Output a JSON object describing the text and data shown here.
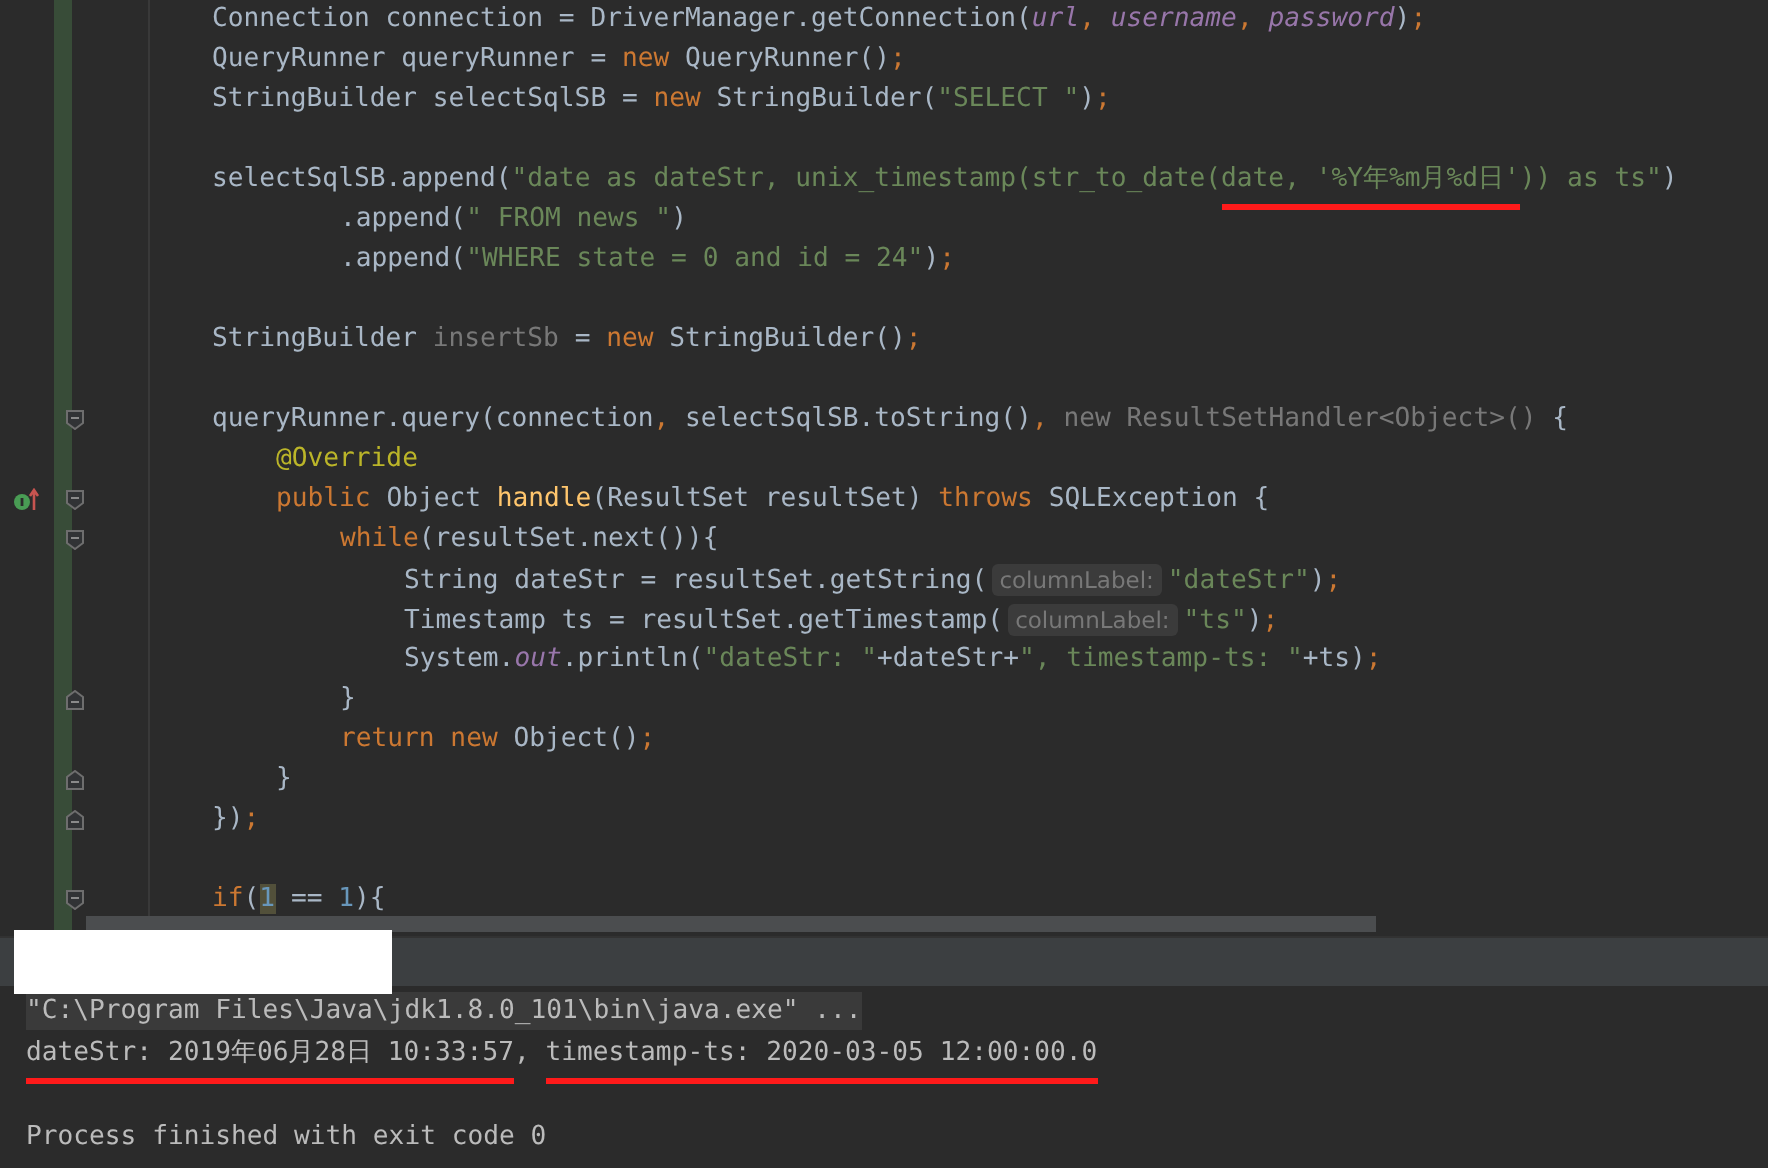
{
  "editor": {
    "lines": [
      {
        "kind": "statement",
        "tokens": [
          {
            "kind": "p",
            "text": "Connection connection = DriverManager.getConnection("
          },
          {
            "kind": "v",
            "text": "url"
          },
          {
            "kind": "c",
            "text": ", "
          },
          {
            "kind": "v",
            "text": "username"
          },
          {
            "kind": "c",
            "text": ", "
          },
          {
            "kind": "v",
            "text": "password"
          },
          {
            "kind": "p",
            "text": ")"
          },
          {
            "kind": "c",
            "text": ";"
          }
        ]
      },
      {
        "kind": "statement",
        "tokens": [
          {
            "kind": "p",
            "text": "QueryRunner queryRunner = "
          },
          {
            "kind": "k",
            "text": "new"
          },
          {
            "kind": "p",
            "text": " QueryRunner()"
          },
          {
            "kind": "c",
            "text": ";"
          }
        ]
      },
      {
        "kind": "statement",
        "tokens": [
          {
            "kind": "p",
            "text": "StringBuilder selectSqlSB = "
          },
          {
            "kind": "k",
            "text": "new"
          },
          {
            "kind": "p",
            "text": " StringBuilder("
          },
          {
            "kind": "s",
            "text": "\"SELECT \""
          },
          {
            "kind": "p",
            "text": ")"
          },
          {
            "kind": "c",
            "text": ";"
          }
        ]
      },
      {
        "kind": "blank"
      },
      {
        "kind": "statement",
        "tokens": [
          {
            "kind": "p",
            "text": "selectSqlSB.append("
          },
          {
            "kind": "s",
            "text": "\"date as dateStr, unix_timestamp(str_to_date("
          },
          {
            "kind": "s",
            "text": "date, '%Y年%m月%d日'",
            "underlined": true
          },
          {
            "kind": "s",
            "text": ")) as ts\""
          },
          {
            "kind": "p",
            "text": ")"
          }
        ]
      },
      {
        "kind": "continuation",
        "tokens": [
          {
            "kind": "p",
            "text": ".append("
          },
          {
            "kind": "s",
            "text": "\" FROM news \""
          },
          {
            "kind": "p",
            "text": ")"
          }
        ]
      },
      {
        "kind": "continuation",
        "tokens": [
          {
            "kind": "p",
            "text": ".append("
          },
          {
            "kind": "s",
            "text": "\"WHERE state = 0 and id = 24\""
          },
          {
            "kind": "p",
            "text": ")"
          },
          {
            "kind": "c",
            "text": ";"
          }
        ]
      },
      {
        "kind": "blank"
      },
      {
        "kind": "statement",
        "tokens": [
          {
            "kind": "p",
            "text": "StringBuilder "
          },
          {
            "kind": "g",
            "text": "insertSb"
          },
          {
            "kind": "p",
            "text": " = "
          },
          {
            "kind": "k",
            "text": "new"
          },
          {
            "kind": "p",
            "text": " StringBuilder()"
          },
          {
            "kind": "c",
            "text": ";"
          }
        ]
      },
      {
        "kind": "blank"
      },
      {
        "kind": "statement",
        "gutter": [
          {
            "kind": "fold-start"
          }
        ],
        "tokens": [
          {
            "kind": "p",
            "text": "queryRunner.query(connection"
          },
          {
            "kind": "c",
            "text": ", "
          },
          {
            "kind": "p",
            "text": "selectSqlSB.toString()"
          },
          {
            "kind": "c",
            "text": ", "
          },
          {
            "kind": "g",
            "text": "new ResultSetHandler<Object>()"
          },
          {
            "kind": "p",
            "text": " {"
          }
        ],
        "children": [
          {
            "kind": "statement",
            "tokens": [
              {
                "kind": "a",
                "text": "@Override"
              }
            ]
          },
          {
            "kind": "statement",
            "gutter": [
              {
                "kind": "override"
              },
              {
                "kind": "fold-start"
              }
            ],
            "tokens": [
              {
                "kind": "k",
                "text": "public "
              },
              {
                "kind": "p",
                "text": "Object "
              },
              {
                "kind": "m",
                "text": "handle"
              },
              {
                "kind": "p",
                "text": "(ResultSet resultSet) "
              },
              {
                "kind": "k",
                "text": "throws "
              },
              {
                "kind": "p",
                "text": "SQLException {"
              }
            ],
            "children": [
              {
                "kind": "statement",
                "gutter": [
                  {
                    "kind": "fold-start"
                  }
                ],
                "tokens": [
                  {
                    "kind": "k",
                    "text": "while"
                  },
                  {
                    "kind": "p",
                    "text": "(resultSet.next()){"
                  }
                ],
                "children": [
                  {
                    "kind": "statement",
                    "tokens": [
                      {
                        "kind": "p",
                        "text": "String dateStr = resultSet.getString("
                      },
                      {
                        "kind": "h",
                        "text": "columnLabel:"
                      },
                      {
                        "kind": "s",
                        "text": "\"dateStr\""
                      },
                      {
                        "kind": "p",
                        "text": ")"
                      },
                      {
                        "kind": "c",
                        "text": ";"
                      }
                    ]
                  },
                  {
                    "kind": "statement",
                    "tokens": [
                      {
                        "kind": "p",
                        "text": "Timestamp ts = resultSet.getTimestamp("
                      },
                      {
                        "kind": "h",
                        "text": "columnLabel:"
                      },
                      {
                        "kind": "s",
                        "text": "\"ts\""
                      },
                      {
                        "kind": "p",
                        "text": ")"
                      },
                      {
                        "kind": "c",
                        "text": ";"
                      }
                    ]
                  },
                  {
                    "kind": "statement",
                    "tokens": [
                      {
                        "kind": "p",
                        "text": "System."
                      },
                      {
                        "kind": "v",
                        "text": "out"
                      },
                      {
                        "kind": "p",
                        "text": ".println("
                      },
                      {
                        "kind": "s",
                        "text": "\"dateStr: \""
                      },
                      {
                        "kind": "p",
                        "text": "+dateStr+"
                      },
                      {
                        "kind": "s",
                        "text": "\", timestamp-ts: \""
                      },
                      {
                        "kind": "p",
                        "text": "+ts)"
                      },
                      {
                        "kind": "c",
                        "text": ";"
                      }
                    ]
                  }
                ]
              },
              {
                "kind": "statement",
                "gutter": [
                  {
                    "kind": "fold-end"
                  }
                ],
                "tokens": [
                  {
                    "kind": "p",
                    "text": "}"
                  }
                ]
              },
              {
                "kind": "statement",
                "tokens": [
                  {
                    "kind": "k",
                    "text": "return new "
                  },
                  {
                    "kind": "p",
                    "text": "Object()"
                  },
                  {
                    "kind": "c",
                    "text": ";"
                  }
                ]
              }
            ]
          },
          {
            "kind": "statement",
            "gutter": [
              {
                "kind": "fold-end"
              }
            ],
            "tokens": [
              {
                "kind": "p",
                "text": "}"
              }
            ]
          }
        ]
      },
      {
        "kind": "statement",
        "gutter": [
          {
            "kind": "fold-end"
          }
        ],
        "tokens": [
          {
            "kind": "p",
            "text": "})"
          },
          {
            "kind": "c",
            "text": ";"
          }
        ]
      },
      {
        "kind": "blank"
      },
      {
        "kind": "statement",
        "gutter": [
          {
            "kind": "fold-start"
          }
        ],
        "tokens": [
          {
            "kind": "k",
            "text": "if"
          },
          {
            "kind": "p",
            "text": "("
          },
          {
            "kind": "n",
            "text": "1",
            "highlighted": true
          },
          {
            "kind": "p",
            "text": " == "
          },
          {
            "kind": "n",
            "text": "1"
          },
          {
            "kind": "p",
            "text": "){"
          }
        ]
      }
    ]
  },
  "console": {
    "lines": [
      {
        "kind": "command",
        "segments": [
          {
            "text": "\"C:\\Program Files\\Java\\jdk1.8.0_101\\bin\\java.exe\" ...",
            "underlined": false
          }
        ]
      },
      {
        "kind": "output",
        "segments": [
          {
            "text": "dateStr: 2019年06月28日 10:33:57",
            "underlined": true
          },
          {
            "text": ", ",
            "underlined": false
          },
          {
            "text": "timestamp-ts: 2020-03-05 12:00:00.0",
            "underlined": true
          }
        ]
      },
      {
        "kind": "blank"
      },
      {
        "kind": "output",
        "segments": [
          {
            "text": "Process finished with exit code 0",
            "underlined": false
          }
        ]
      }
    ]
  }
}
